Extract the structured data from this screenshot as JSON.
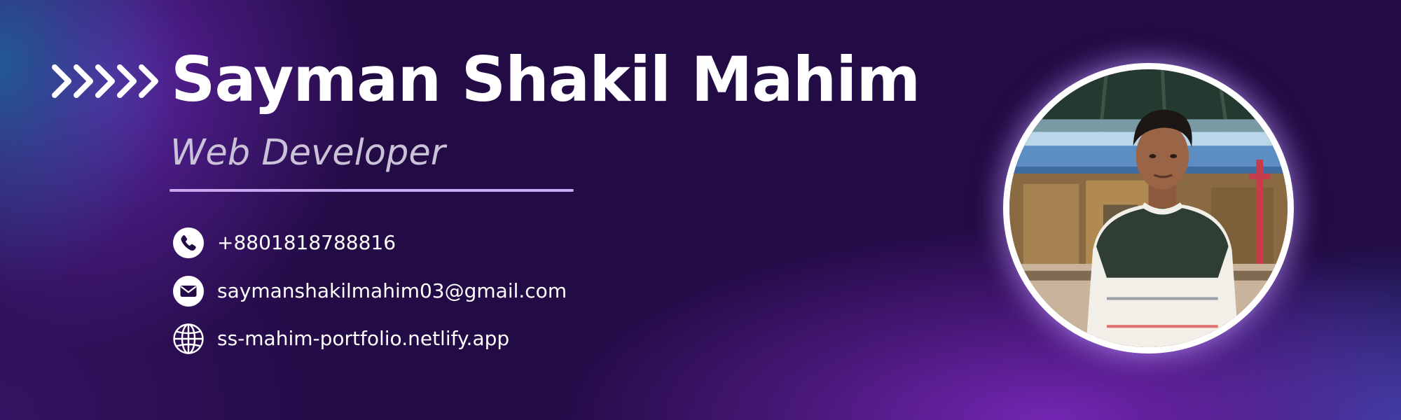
{
  "profile": {
    "name": "Sayman Shakil Mahim",
    "role": "Web Developer"
  },
  "contacts": {
    "phone": {
      "icon": "phone-icon",
      "text": "+8801818788816"
    },
    "email": {
      "icon": "mail-icon",
      "text": "saymanshakilmahim03@gmail.com"
    },
    "website": {
      "icon": "globe-icon",
      "text": "ss-mahim-portfolio.netlify.app"
    }
  },
  "colors": {
    "background": "#230b45",
    "accent": "#c9a8f2",
    "role_text": "#c9c2d8",
    "name_text": "#ffffff"
  },
  "decor": {
    "chevrons": "chevrons-right-icon",
    "photo": "profile-photo"
  }
}
